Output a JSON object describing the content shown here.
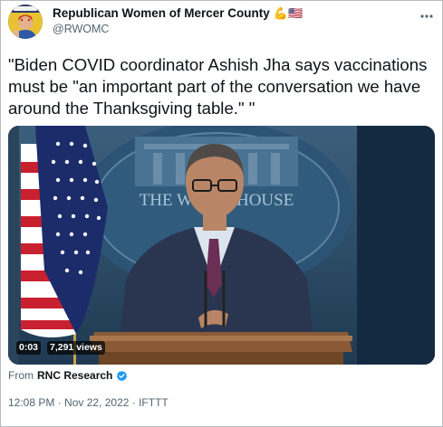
{
  "tweet": {
    "author_name": "Republican Women of Mercer County",
    "author_emojis": "💪🇺🇸",
    "author_handle": "@RWOMC",
    "text": "\"Biden COVID coordinator Ashish Jha says vaccinations must be \"an important part of the conversation we have around the Thanksgiving table.\" \"",
    "video": {
      "elapsed": "0:03",
      "views": "7,291 views",
      "background_sign": "THE WHITE HOUSE"
    },
    "source_prefix": "From",
    "source_name": "RNC Research",
    "timestamp": "12:08 PM · Nov 22, 2022 · IFTTT"
  },
  "icons": {
    "more": "more-dots-icon",
    "verified": "verified-badge-icon"
  },
  "colors": {
    "verified_blue": "#1d9bf0",
    "text_primary": "#0f1419",
    "text_secondary": "#536471"
  }
}
